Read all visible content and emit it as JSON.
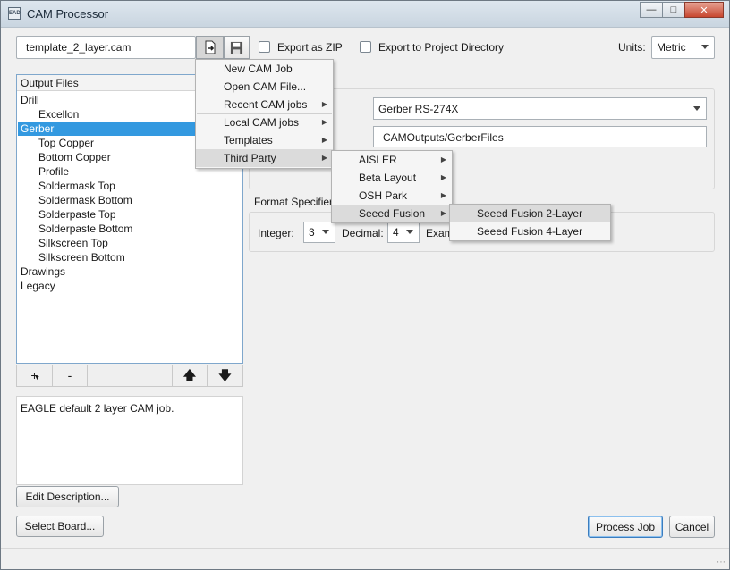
{
  "window": {
    "title": "CAM Processor",
    "app_icon_text": "EAD"
  },
  "toolbar": {
    "job_file": "template_2_layer.cam",
    "export_zip_label": "Export as ZIP",
    "export_project_label": "Export to Project Directory",
    "units_label": "Units:",
    "units_value": "Metric"
  },
  "output_files": {
    "header": "Output Files",
    "items": [
      {
        "label": "Drill",
        "level": 0
      },
      {
        "label": "Excellon",
        "level": 1
      },
      {
        "label": "Gerber",
        "level": 0,
        "selected": true
      },
      {
        "label": "Top Copper",
        "level": 1
      },
      {
        "label": "Bottom Copper",
        "level": 1
      },
      {
        "label": "Profile",
        "level": 1
      },
      {
        "label": "Soldermask Top",
        "level": 1
      },
      {
        "label": "Soldermask Bottom",
        "level": 1
      },
      {
        "label": "Solderpaste Top",
        "level": 1
      },
      {
        "label": "Solderpaste Bottom",
        "level": 1
      },
      {
        "label": "Silkscreen Top",
        "level": 1
      },
      {
        "label": "Silkscreen Bottom",
        "level": 1
      },
      {
        "label": "Drawings",
        "level": 0
      },
      {
        "label": "Legacy",
        "level": 0
      }
    ],
    "add_label": "+",
    "remove_label": "-"
  },
  "description": "EAGLE default 2 layer CAM job.",
  "buttons": {
    "edit_description": "Edit Description...",
    "select_board": "Select Board...",
    "process_job": "Process Job",
    "cancel": "Cancel"
  },
  "settings": {
    "format_value": "Gerber RS-274X",
    "output_path": "CAMOutputs/GerberFiles",
    "format_spec_label": "Format Specifier",
    "integer_label": "Integer:",
    "integer_value": "3",
    "decimal_label": "Decimal:",
    "decimal_value": "4",
    "example_label": "Exam"
  },
  "menus": {
    "main": [
      {
        "label": "New CAM Job",
        "submenu": false
      },
      {
        "label": "Open CAM File...",
        "submenu": false
      },
      {
        "label": "Recent CAM jobs",
        "submenu": true
      },
      {
        "label": "Local CAM jobs",
        "submenu": true
      },
      {
        "label": "Templates",
        "submenu": true
      },
      {
        "label": "Third Party",
        "submenu": true,
        "highlighted": true
      }
    ],
    "third_party": [
      {
        "label": "AISLER",
        "submenu": true
      },
      {
        "label": "Beta Layout",
        "submenu": true
      },
      {
        "label": "OSH Park",
        "submenu": true
      },
      {
        "label": "Seeed Fusion",
        "submenu": true,
        "highlighted": true
      }
    ],
    "seeed": [
      {
        "label": "Seeed Fusion 2-Layer",
        "highlighted": true
      },
      {
        "label": "Seeed Fusion 4-Layer"
      }
    ]
  },
  "colors": {
    "selection": "#3399e0",
    "accent_border": "#3b7dbf"
  }
}
